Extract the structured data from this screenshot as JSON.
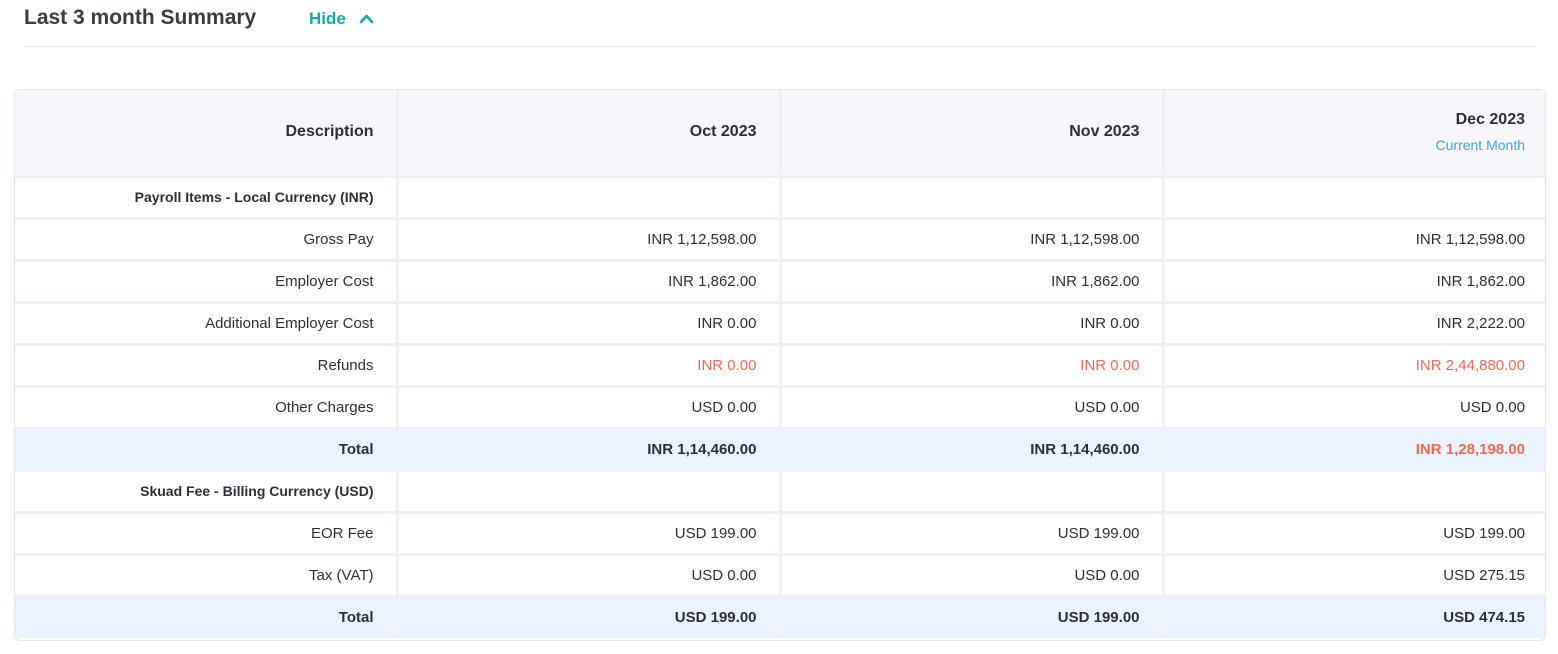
{
  "summary": {
    "title": "Last 3 month Summary",
    "toggle_label": "Hide"
  },
  "table": {
    "headers": {
      "description": "Description",
      "months": [
        {
          "label": "Oct 2023",
          "sub": ""
        },
        {
          "label": "Nov 2023",
          "sub": ""
        },
        {
          "label": "Dec 2023",
          "sub": "Current Month"
        }
      ]
    },
    "sections": [
      {
        "title": "Payroll Items - Local Currency (INR)",
        "rows": [
          {
            "label": "Gross Pay",
            "values": [
              "INR 1,12,598.00",
              "INR 1,12,598.00",
              "INR 1,12,598.00"
            ]
          },
          {
            "label": "Employer Cost",
            "values": [
              "INR 1,862.00",
              "INR 1,862.00",
              "INR 1,862.00"
            ]
          },
          {
            "label": "Additional Employer Cost",
            "values": [
              "INR 0.00",
              "INR 0.00",
              "INR 2,222.00"
            ]
          },
          {
            "label": "Refunds",
            "values": [
              "INR 0.00",
              "INR 0.00",
              "INR 2,44,880.00"
            ]
          },
          {
            "label": "Other Charges",
            "values": [
              "USD 0.00",
              "USD 0.00",
              "USD 0.00"
            ]
          }
        ],
        "total": {
          "label": "Total",
          "values": [
            "INR 1,14,460.00",
            "INR 1,14,460.00",
            "INR 1,28,198.00"
          ]
        }
      },
      {
        "title": "Skuad Fee - Billing Currency (USD)",
        "rows": [
          {
            "label": "EOR Fee",
            "values": [
              "USD 199.00",
              "USD 199.00",
              "USD 199.00"
            ]
          },
          {
            "label": "Tax (VAT)",
            "values": [
              "USD 0.00",
              "USD 0.00",
              "USD 275.15"
            ]
          }
        ],
        "total": {
          "label": "Total",
          "values": [
            "USD 199.00",
            "USD 199.00",
            "USD 474.15"
          ]
        }
      }
    ]
  },
  "colors": {
    "accent_teal": "#1aa9a0",
    "current_month_blue": "#3aa3e8",
    "negative_red": "#ee6a55",
    "total_row_bg": "#eaf3fd",
    "header_bg": "#f7f7fb"
  },
  "icons": {
    "toggle": "chevron-up-icon"
  }
}
